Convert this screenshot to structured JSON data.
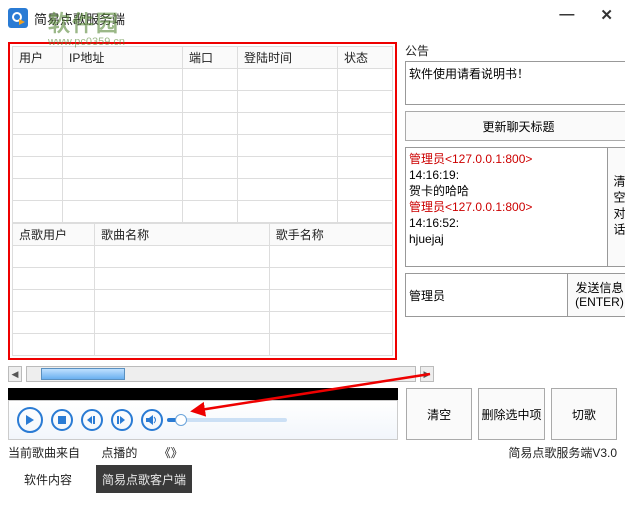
{
  "title": "简易点歌服务端",
  "watermark": {
    "line1": "软件园",
    "line2": "www.pc0359.cn"
  },
  "notice_label": "公告",
  "notice_text": "软件使用请看说明书！",
  "btn_update": "更新聊天标题",
  "chat": [
    {
      "admin": "管理员<127.0.0.1:800>",
      "time": "14:16:19:",
      "msg": "贺卡的哈哈"
    },
    {
      "admin": "管理员<127.0.0.1:800>",
      "time": "14:16:52:",
      "msg": "hjuejaj"
    }
  ],
  "btn_clearchat": "清空对话",
  "send_value": "管理员",
  "btn_send_l1": "发送信息",
  "btn_send_l2": "(ENTER)",
  "clients_cols": {
    "user": "用户",
    "ip": "IP地址",
    "port": "端口",
    "time": "登陆时间",
    "status": "状态"
  },
  "queue_cols": {
    "req": "点歌用户",
    "song": "歌曲名称",
    "singer": "歌手名称"
  },
  "actions": {
    "clear": "清空",
    "remove": "删除选中项",
    "next": "切歌"
  },
  "status": {
    "from_label": "当前歌曲来自",
    "dj_label": "点播的",
    "dj_val": "《》",
    "version": "简易点歌服务端V3.0"
  },
  "tabs": {
    "a": "软件内容",
    "b": "简易点歌客户端"
  }
}
